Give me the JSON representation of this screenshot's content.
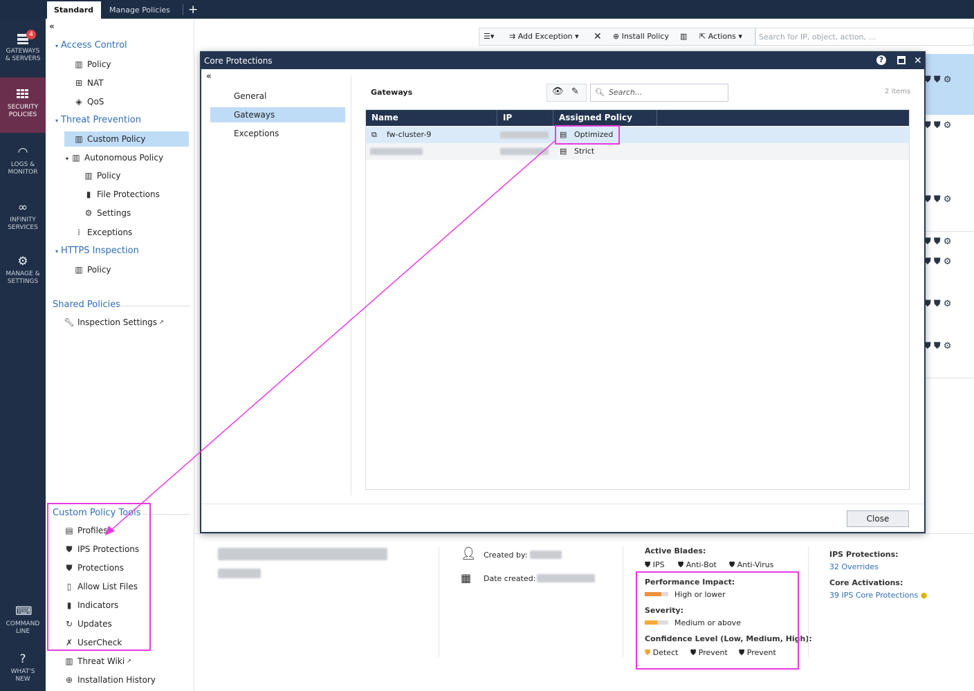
{
  "tabs": {
    "standard": "Standard",
    "close": "×",
    "manage": "Manage Policies",
    "add": "+"
  },
  "rail": {
    "gateways": {
      "l1": "GATEWAYS",
      "l2": "& SERVERS",
      "badge": "4"
    },
    "security": {
      "l1": "SECURITY",
      "l2": "POLICIES"
    },
    "logs": {
      "l1": "LOGS &",
      "l2": "MONITOR"
    },
    "infinity": {
      "l1": "INFINITY",
      "l2": "SERVICES"
    },
    "manage": {
      "l1": "MANAGE &",
      "l2": "SETTINGS"
    },
    "cmd": {
      "l1": "COMMAND",
      "l2": "LINE"
    },
    "whatsnew": {
      "l1": "WHAT'S",
      "l2": "NEW"
    }
  },
  "tree": {
    "collapse": "«",
    "access_control": "Access Control",
    "ac_policy": "Policy",
    "nat": "NAT",
    "qos": "QoS",
    "threat_prevention": "Threat Prevention",
    "custom_policy": "Custom Policy",
    "autonomous_policy": "Autonomous Policy",
    "ap_policy": "Policy",
    "file_protections": "File Protections",
    "settings": "Settings",
    "exceptions": "Exceptions",
    "https_inspection": "HTTPS Inspection",
    "https_policy": "Policy",
    "shared_policies": "Shared Policies",
    "inspection_settings": "Inspection Settings",
    "custom_policy_tools": "Custom Policy Tools",
    "tools": [
      "Profiles",
      "IPS Protections",
      "Protections",
      "Allow List Files",
      "Indicators",
      "Updates",
      "UserCheck"
    ],
    "threat_wiki": "Threat Wiki",
    "installation_history": "Installation History"
  },
  "toolbar": {
    "add_exception": "Add Exception",
    "install_policy": "Install Policy",
    "actions": "Actions",
    "search_placeholder": "Search for IP, object, action, ..."
  },
  "details": {
    "created_by": "Created by:",
    "date_created": "Date created:",
    "active_blades": "Active Blades:",
    "ips": "IPS",
    "anti_bot": "Anti-Bot",
    "anti_virus": "Anti-Virus",
    "performance_impact": "Performance Impact:",
    "performance_value": "High or lower",
    "severity": "Severity:",
    "severity_value": "Medium or above",
    "confidence": "Confidence Level (Low, Medium, High):",
    "conf_low": "Detect",
    "conf_med": "Prevent",
    "conf_high": "Prevent",
    "ips_protections": "IPS Protections:",
    "overrides": "32 Overrides",
    "core_activations": "Core Activations:",
    "core_link": "39 IPS Core Protections"
  },
  "modal": {
    "title": "Core Protections",
    "help": "?",
    "maximize": "□",
    "close_x": "✕",
    "collapse": "«",
    "nav": [
      "General",
      "Gateways",
      "Exceptions"
    ],
    "section": "Gateways",
    "search_placeholder": "Search...",
    "items": "2 items",
    "columns": [
      "Name",
      "IP",
      "Assigned Policy"
    ],
    "rows": [
      {
        "name": "fw-cluster-9",
        "policy": "Optimized"
      },
      {
        "name": "",
        "policy": "Strict"
      }
    ],
    "close": "Close"
  },
  "colors": {
    "highlight": "#e83ae2",
    "accent": "#2f6db5",
    "header": "#233450",
    "selection": "#bfdcf7"
  }
}
